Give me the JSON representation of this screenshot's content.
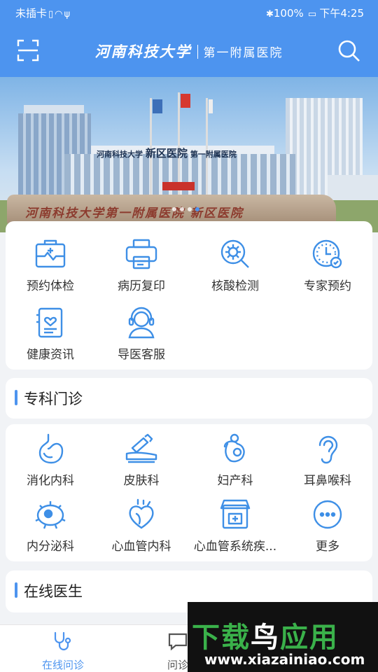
{
  "status_bar": {
    "carrier": "未插卡",
    "battery": "100%",
    "time": "下午4:25"
  },
  "header": {
    "university": "河南科技大学",
    "department": "第一附属医院"
  },
  "banner": {
    "building_sign_small": "河南科技大学",
    "building_sign_big": "新区医院",
    "building_sign_dept": "第一附属医院",
    "stone_inscription": "河南科技大学第一附属医院 新区医院",
    "slides": 4,
    "active_slide": 4
  },
  "quick_services": [
    {
      "label": "预约体检",
      "icon": "medical-kit-icon"
    },
    {
      "label": "病历复印",
      "icon": "printer-icon"
    },
    {
      "label": "核酸检测",
      "icon": "virus-magnifier-icon"
    },
    {
      "label": "专家预约",
      "icon": "clock-appointment-icon"
    },
    {
      "label": "健康资讯",
      "icon": "health-news-icon"
    },
    {
      "label": "导医客服",
      "icon": "customer-service-icon"
    }
  ],
  "specialty_section": {
    "title": "专科门诊"
  },
  "specialties": [
    {
      "label": "消化内科",
      "icon": "stomach-icon"
    },
    {
      "label": "皮肤科",
      "icon": "skin-cream-icon"
    },
    {
      "label": "妇产科",
      "icon": "pregnancy-icon"
    },
    {
      "label": "耳鼻喉科",
      "icon": "ear-icon"
    },
    {
      "label": "内分泌科",
      "icon": "cell-icon"
    },
    {
      "label": "心血管内科",
      "icon": "heart-icon"
    },
    {
      "label": "心血管系统疾...",
      "icon": "clinic-icon"
    },
    {
      "label": "更多",
      "icon": "more-icon"
    }
  ],
  "online_section": {
    "title": "在线医生"
  },
  "tabbar": {
    "tab1": "在线问诊",
    "tab2": "问诊"
  },
  "watermark": {
    "brand_part1": "下载",
    "brand_part2": "鸟",
    "brand_part3": "应用",
    "url": "www.xiazainiao.com"
  },
  "colors": {
    "primary": "#4d94ef",
    "icon_blue": "#3e8fe6",
    "background": "#f1f3f6"
  }
}
